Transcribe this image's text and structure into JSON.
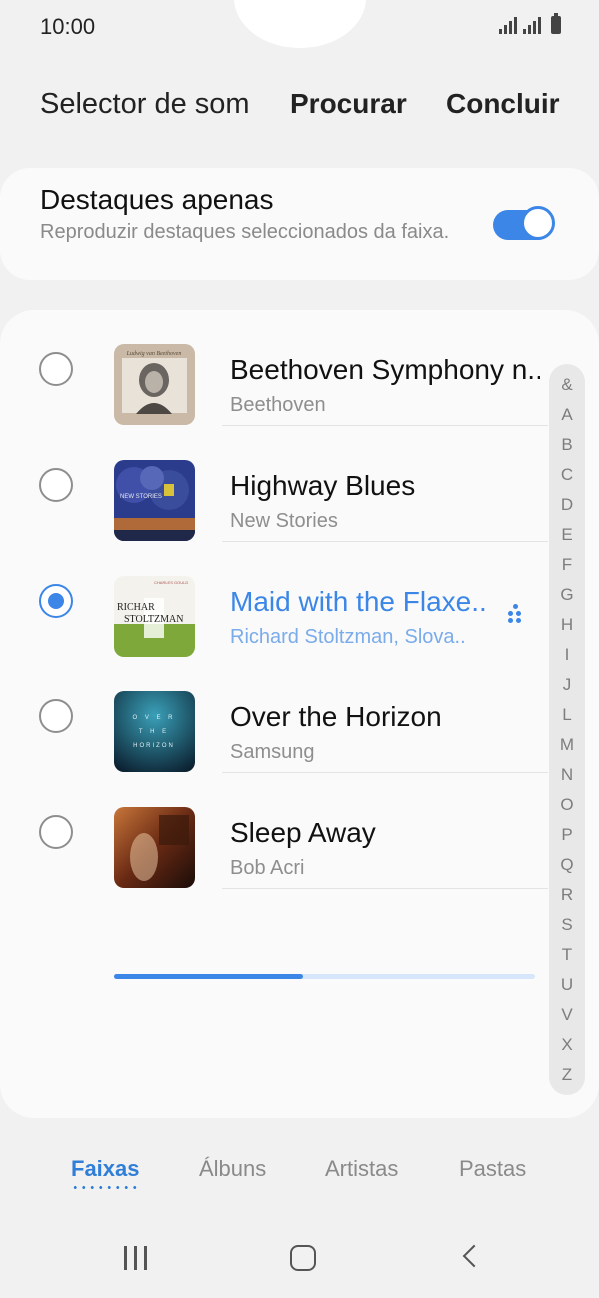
{
  "status_bar": {
    "time": "10:00"
  },
  "header": {
    "title": "Selector de som",
    "search_label": "Procurar",
    "done_label": "Concluir"
  },
  "highlights": {
    "title": "Destaques apenas",
    "subtitle": "Reproduzir destaques seleccionados da faixa.",
    "enabled": true
  },
  "tracks": [
    {
      "title": "Beethoven Symphony n..",
      "artist": "Beethoven",
      "selected": false,
      "art_icon": "album-art-beethoven"
    },
    {
      "title": "Highway Blues",
      "artist": "New Stories",
      "selected": false,
      "art_icon": "album-art-highway-blues"
    },
    {
      "title": "Maid with the Flaxe..",
      "artist": "Richard Stoltzman, Slova..",
      "selected": true,
      "art_icon": "album-art-stoltzman",
      "progress": 0.45
    },
    {
      "title": "Over the Horizon",
      "artist": "Samsung",
      "selected": false,
      "art_icon": "album-art-over-the-horizon"
    },
    {
      "title": "Sleep Away",
      "artist": "Bob Acri",
      "selected": false,
      "art_icon": "album-art-sleep-away"
    }
  ],
  "index_letters": [
    "&",
    "A",
    "B",
    "C",
    "D",
    "E",
    "F",
    "G",
    "H",
    "I",
    "J",
    "L",
    "M",
    "N",
    "O",
    "P",
    "Q",
    "R",
    "S",
    "T",
    "U",
    "V",
    "X",
    "Z"
  ],
  "tabs": [
    {
      "label": "Faixas",
      "active": true
    },
    {
      "label": "Álbuns",
      "active": false
    },
    {
      "label": "Artistas",
      "active": false
    },
    {
      "label": "Pastas",
      "active": false
    }
  ],
  "colors": {
    "accent": "#3b86e6",
    "tab_active": "#2f7fd8"
  }
}
